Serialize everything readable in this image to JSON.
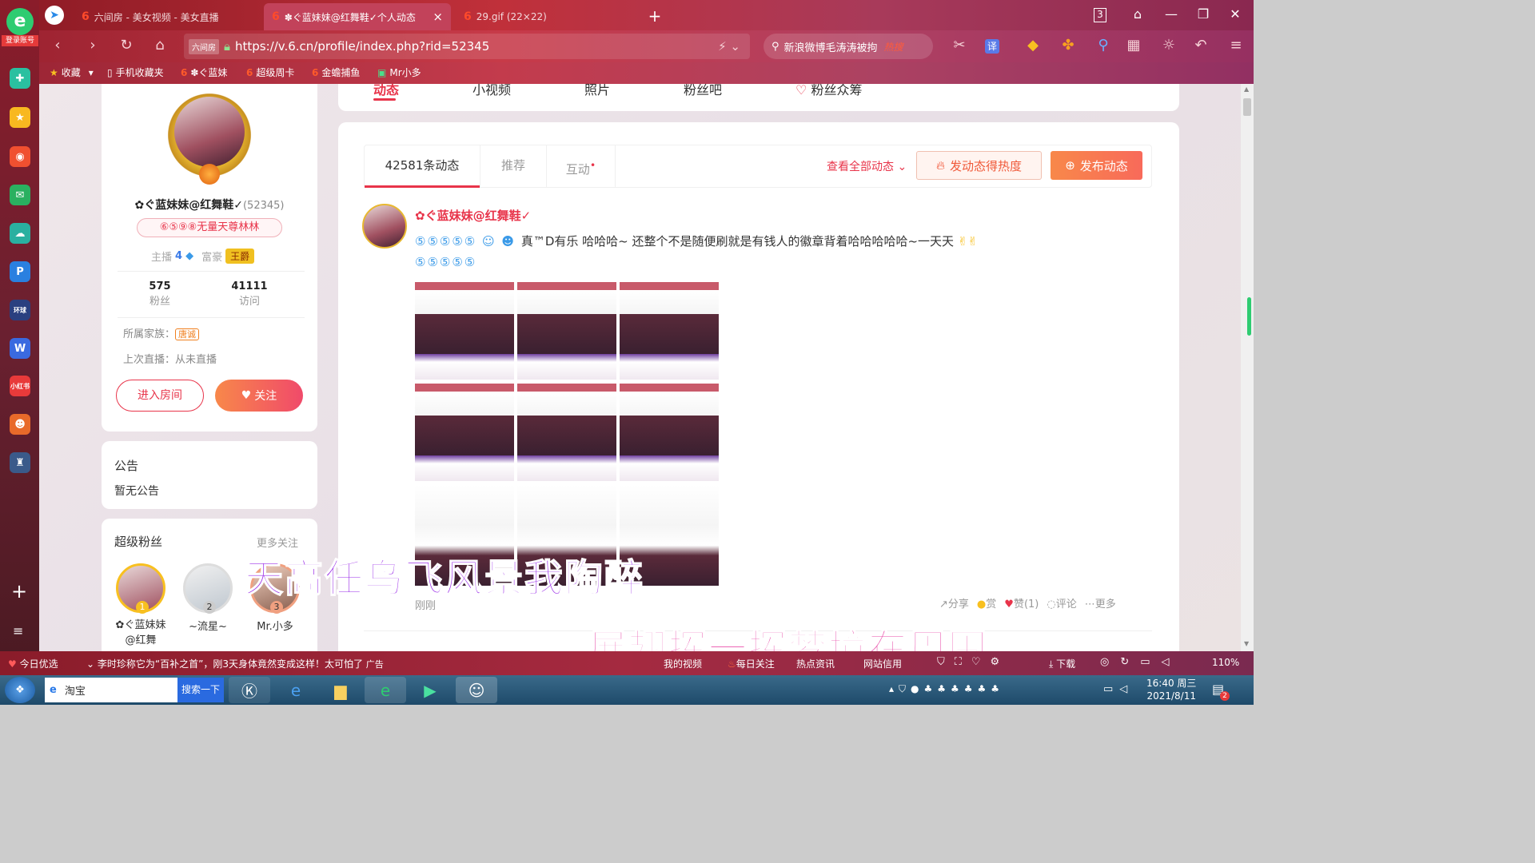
{
  "browser": {
    "tabs": [
      {
        "label": "六间房 - 美女视频 - 美女直播"
      },
      {
        "label": "✽ぐ蓝妹妹@红舞鞋✓个人动态"
      },
      {
        "label": "29.gif (22×22)"
      }
    ],
    "tab_counter": "3",
    "url": "https://v.6.cn/profile/index.php?rid=52345",
    "site_badge": "六间房",
    "search_text": "新浪微博毛涛涛被拘",
    "hot_badge": "热搜",
    "translate_label": "译",
    "login_label": "登录账号",
    "bookmarks": [
      "收藏",
      "手机收藏夹",
      "✽ぐ蓝妹",
      "超级周卡",
      "金蟾捕鱼",
      "Mr小多"
    ]
  },
  "nav_tabs": [
    "动态",
    "小视频",
    "照片",
    "粉丝吧",
    "粉丝众筹"
  ],
  "profile": {
    "name": "✿ぐ蓝妹妹@红舞鞋✓",
    "rid": "(52345)",
    "badge": "⑥⑤⑨⑧无量天尊林林",
    "anchor_label": "主播",
    "anchor_level": "4",
    "rich_label": "富豪",
    "rich_badge": "王爵",
    "fans_count": "575",
    "fans_label": "粉丝",
    "visits_count": "41111",
    "visits_label": "访问",
    "family_label": "所属家族：",
    "family_tag": "唐诚",
    "last_live": "上次直播：从未直播",
    "enter_room": "进入房间",
    "follow": "关注"
  },
  "notice": {
    "title": "公告",
    "text": "暂无公告"
  },
  "superfans": {
    "title": "超级粉丝",
    "more": "更多关注",
    "fans": [
      {
        "rank": "1",
        "name": "✿ぐ蓝妹妹@红舞"
      },
      {
        "rank": "2",
        "name": "~流星~"
      },
      {
        "rank": "3",
        "name": "Mr.小多"
      }
    ]
  },
  "feed_tabs": {
    "count": "42581条动态",
    "recommend": "推荐",
    "interact": "互动",
    "view_all": "查看全部动态",
    "heat": "发动态得热度",
    "publish": "发布动态"
  },
  "post": {
    "author": "✿ぐ蓝妹妹@红舞鞋✓",
    "text": "真™D有乐 哈哈哈~ 还整个不是随便刷就是有钱人的徽章背着哈哈哈哈哈~一天天",
    "time": "刚刚",
    "actions": {
      "share": "分享",
      "reward": "赏",
      "like": "赞(1)",
      "comment": "评论",
      "more": "更多"
    }
  },
  "lyrics": [
    "天高任鸟飞风景我陶醉",
    "展翅挥一挥梦境在周围"
  ],
  "statusbar": {
    "news_label": "今日优选",
    "news": "李时珍称它为“百补之首”，刚3天身体竟然变成这样！太可怕了",
    "ad": "广告",
    "my_video": "我的视频",
    "daily": "每日关注",
    "hot_news": "热点资讯",
    "credit": "网站信用",
    "download": "下载",
    "zoom": "110%"
  },
  "taskbar": {
    "taobao": "淘宝",
    "search_btn": "搜索一下",
    "time": "16:40 周三",
    "date": "2021/8/11",
    "notif": "2"
  },
  "colors": {
    "brand": "#e8344a",
    "accent": "#f77b4c",
    "tabbar": "#b8303e"
  }
}
